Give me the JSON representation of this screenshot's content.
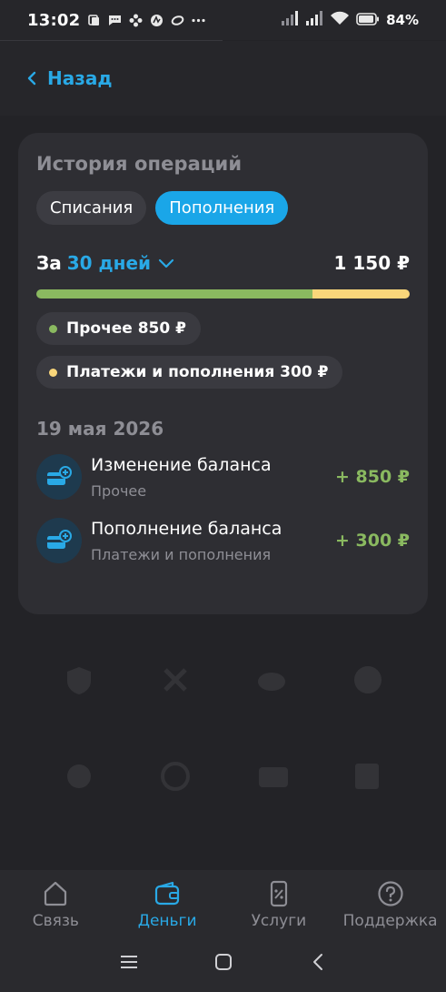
{
  "status_bar": {
    "time": "13:02",
    "battery": "84%"
  },
  "header": {
    "back_label": "Назад"
  },
  "card": {
    "title": "История операций",
    "tabs": [
      {
        "label": "Списания",
        "active": false
      },
      {
        "label": "Пополнения",
        "active": true
      }
    ],
    "period_prefix": "За",
    "period_value": "30 дней",
    "total": "1 150 ₽",
    "breakdown": [
      {
        "label": "Прочее 850 ₽",
        "color": "#8ab960",
        "share": 0.739
      },
      {
        "label": "Платежи и пополнения 300 ₽",
        "color": "#f9d67a",
        "share": 0.261
      }
    ],
    "date_group": "19 мая 2026",
    "operations": [
      {
        "title": "Изменение баланса",
        "category": "Прочее",
        "amount": "+ 850 ₽"
      },
      {
        "title": "Пополнение баланса",
        "category": "Платежи и пополнения",
        "amount": "+ 300 ₽"
      }
    ]
  },
  "bottom_nav": {
    "items": [
      {
        "label": "Связь",
        "icon": "home-icon",
        "active": false
      },
      {
        "label": "Деньги",
        "icon": "wallet-icon",
        "active": true
      },
      {
        "label": "Услуги",
        "icon": "services-icon",
        "active": false
      },
      {
        "label": "Поддержка",
        "icon": "help-icon",
        "active": false
      }
    ]
  },
  "colors": {
    "accent": "#29a9e6",
    "positive": "#8ab960"
  }
}
